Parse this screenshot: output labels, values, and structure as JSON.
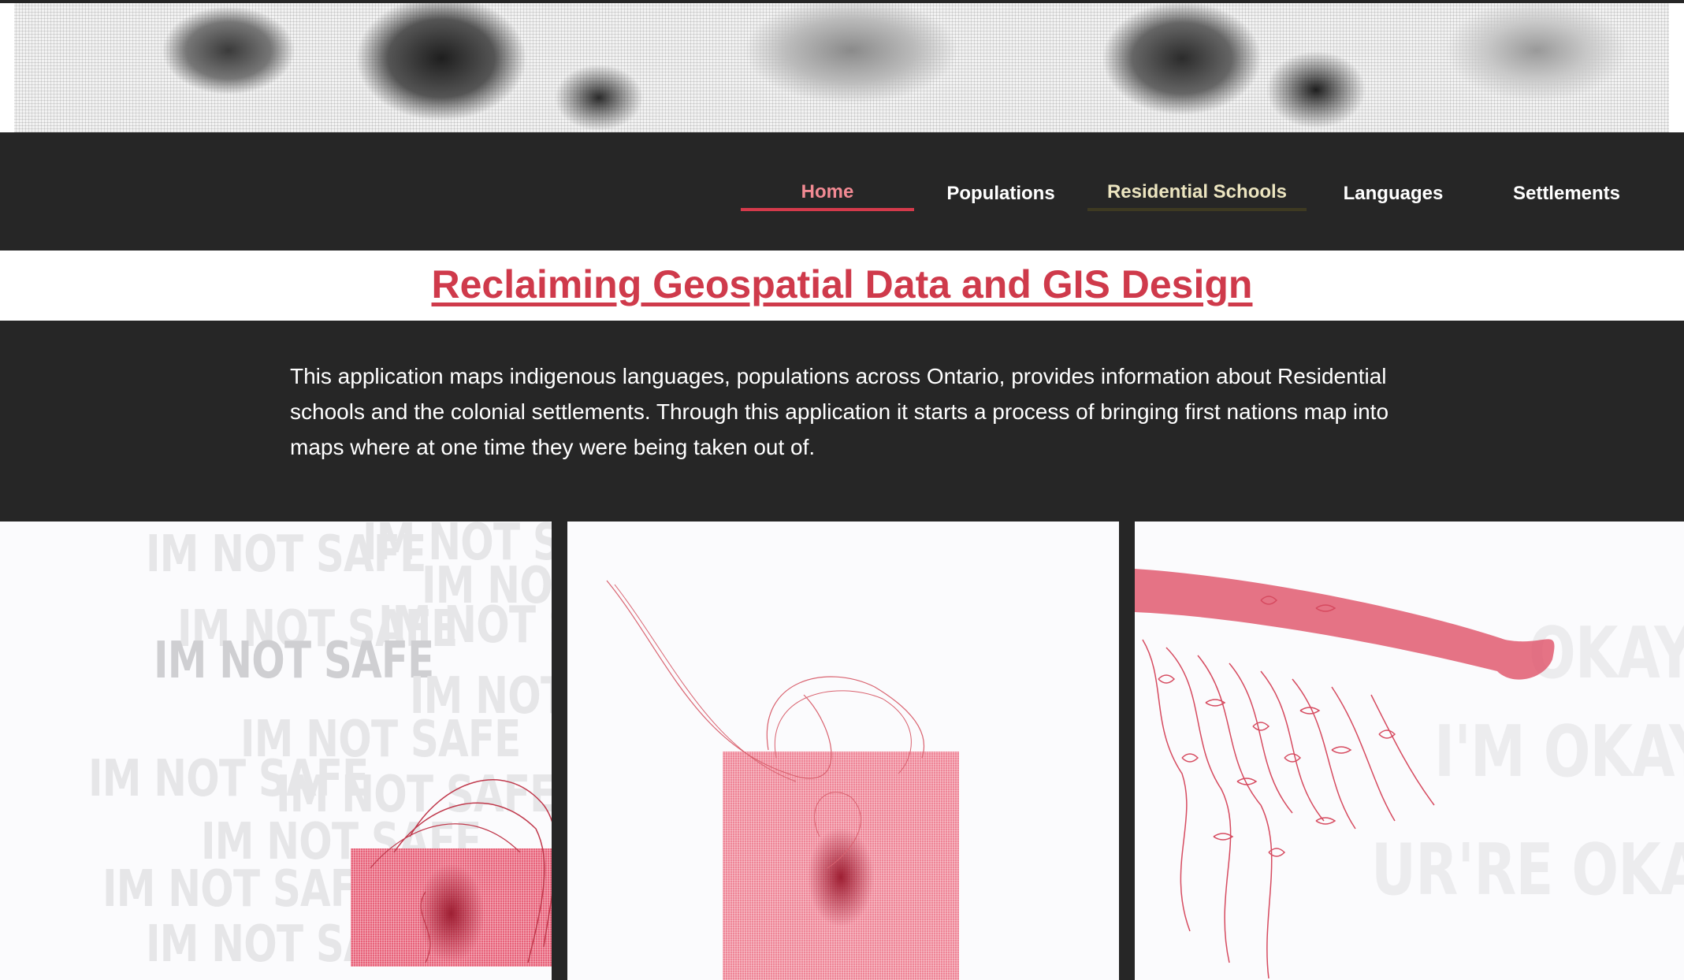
{
  "nav": {
    "items": [
      {
        "label": "Home",
        "state": "active"
      },
      {
        "label": "Populations",
        "state": "normal"
      },
      {
        "label": "Residential Schools",
        "state": "hover"
      },
      {
        "label": "Languages",
        "state": "normal"
      },
      {
        "label": "Settlements",
        "state": "normal"
      }
    ]
  },
  "main": {
    "title": "Reclaiming Geospatial Data and GIS Design",
    "description": "This application maps indigenous languages, populations across Ontario, provides information about Residential schools and the colonial settlements. Through this application it starts a process of bringing first nations map into maps where at one time they were being taken out of."
  },
  "gallery": {
    "panel1_watermark": "IM NOT SAFE",
    "panel3_watermark_1": "OKAY",
    "panel3_watermark_2": "I'M OKAY",
    "panel3_watermark_3": "UR'RE OKAY"
  },
  "colors": {
    "nav_background": "#262626",
    "accent_red": "#cf3a4b",
    "active_nav_text": "#f28a93",
    "hover_nav_text": "#ece5c0",
    "artwork_red": "#e8627a"
  }
}
